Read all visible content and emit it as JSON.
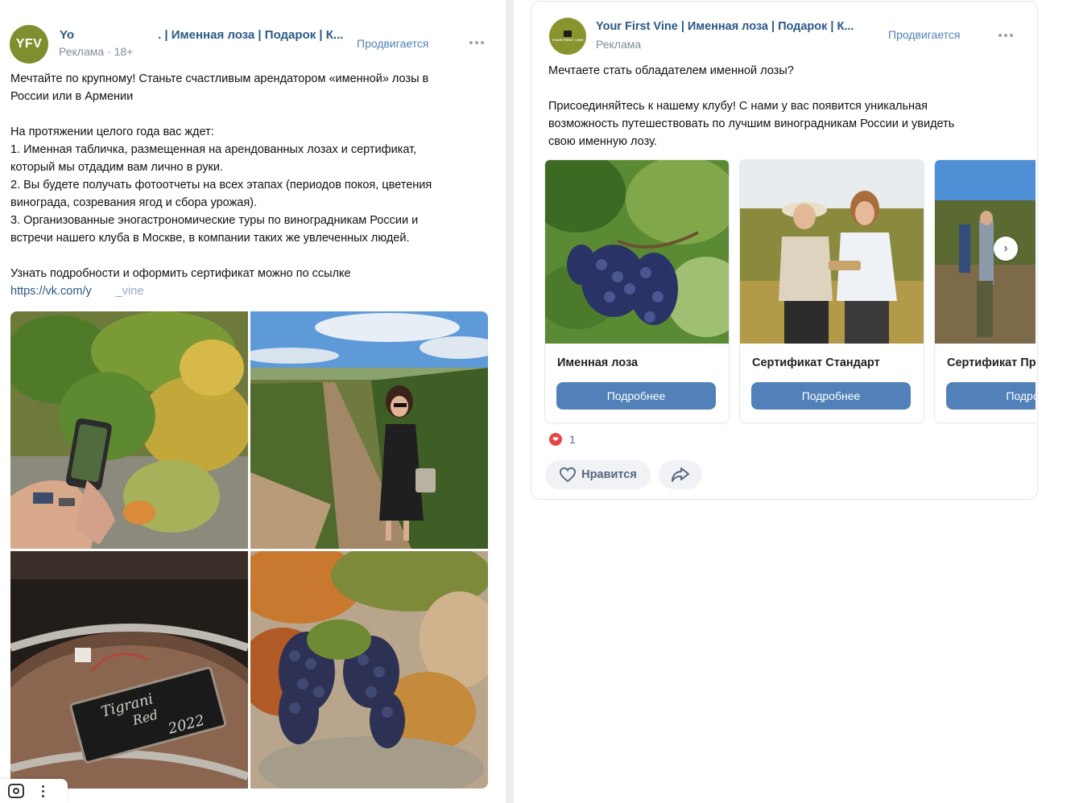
{
  "left_post": {
    "author_name": "Yo",
    "author_name_rest": ". | Именная лоза | Подарок | К...",
    "avatar_initials": "YFV",
    "subtitle": "Реклама · 18+",
    "promoted_label": "Продвигается",
    "text_lines": [
      "Мечтайте по крупному! Станьте счастливым арендатором «именной» лозы в",
      "России или в Армении",
      "",
      "На протяжении целого года вас ждет:",
      "1. Именная табличка, размещенная на арендованных лозах и сертификат,",
      "который мы отдадим вам лично в руки.",
      "2. Вы будете получать фотоотчеты на всех этапах (периодов покоя, цветения",
      "винограда, созревания ягод и сбора урожая).",
      "3. Организованные эногастрономические туры по виноградникам России и",
      "встречи нашего клуба в Москве, в компании таких же увлеченных людей.",
      "",
      "Узнать подробности и оформить сертификат можно по ссылке"
    ],
    "link_text": "https://vk.com/y",
    "link_text_rest": "_vine",
    "barrel_label_line1": "Tigrani",
    "barrel_label_line2": "Red",
    "barrel_label_line3": "2022"
  },
  "right_post": {
    "author_name": "Your First Vine | Именная лоза | Подарок | К...",
    "avatar_logo_text": "YOUR FIRST VINE",
    "subtitle": "Реклама",
    "promoted_label": "Продвигается",
    "text_lines": [
      "Мечтаете стать обладателем именной лозы?",
      "",
      "Присоединяйтесь к нашему клубу! С нами у вас появится уникальная",
      "возможность путешествовать по лучшим виноградникам России и увидеть",
      "свою именную лозу."
    ],
    "cards": [
      {
        "title": "Именная лоза",
        "button": "Подробнее"
      },
      {
        "title": "Сертификат Стандарт",
        "button": "Подробнее"
      },
      {
        "title": "Сертификат Пр",
        "button": "Подроб"
      }
    ],
    "reaction_count": "1",
    "like_label": "Нравится"
  },
  "colors": {
    "accent": "#5181b8",
    "link": "#2a5885",
    "muted": "#818c99",
    "avatar_green": "#7f8f2e",
    "reaction_red": "#e64646"
  },
  "icons": [
    "more-icon",
    "heart-icon",
    "share-icon",
    "chevron-right-icon",
    "camera-icon",
    "kebab-icon"
  ]
}
